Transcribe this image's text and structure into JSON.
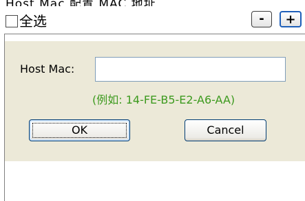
{
  "header": {
    "select_all_label": "全选",
    "minus_label": "-",
    "plus_label": "+"
  },
  "form": {
    "host_mac_label": "Host Mac:",
    "host_mac_value": "",
    "example_text": "(例如: 14-FE-B5-E2-A6-AA)"
  },
  "buttons": {
    "ok_label": "OK",
    "cancel_label": "Cancel"
  },
  "colors": {
    "panel_bg": "#ece9d8",
    "example_text": "#3c9a1e",
    "plus_border": "#1e5fb9"
  }
}
